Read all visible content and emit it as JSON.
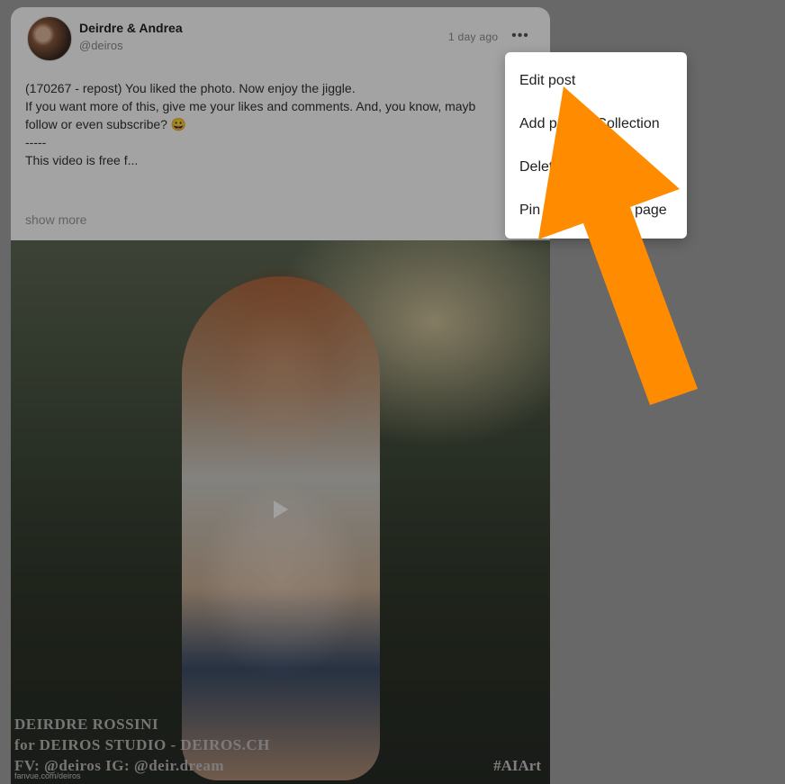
{
  "post": {
    "author": "Deirdre & Andrea",
    "handle": "@deiros",
    "time": "1 day ago",
    "more_icon": "•••",
    "text_lines": [
      "(170267 - repost) You liked the photo. Now enjoy the jiggle.",
      "",
      "If you want more of this, give me your likes and comments. And, you know, mayb",
      "follow or even subscribe? 😀",
      "-----",
      "",
      "This video is free f..."
    ],
    "show_more": "show more"
  },
  "media": {
    "watermark_line1": "DEIRDRE ROSSINI",
    "watermark_line2": "for DEIROS STUDIO - DEIROS.CH",
    "watermark_line3": "FV: @deiros   IG: @deir.dream",
    "watermark_tag": "#AIArt",
    "source_url": "fanvue.com/deiros"
  },
  "menu": {
    "items": [
      {
        "label": "Edit post"
      },
      {
        "label": "Add post to Collection"
      },
      {
        "label": "Delete post"
      },
      {
        "label": "Pin post to profile page"
      }
    ]
  },
  "annotation": {
    "arrow_color": "#ff8c00"
  }
}
